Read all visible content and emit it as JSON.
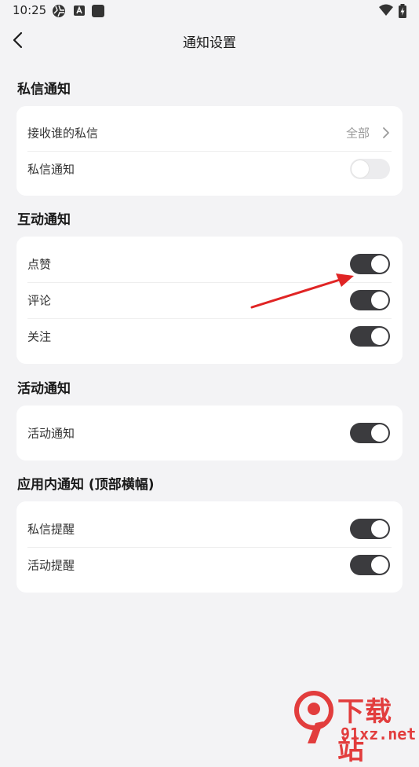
{
  "status_bar": {
    "time": "10:25",
    "icons": [
      "aperture-icon",
      "a-box-icon",
      "square-icon",
      "wifi-icon",
      "battery-charging-icon"
    ]
  },
  "header": {
    "title": "通知设置",
    "back_icon": "chevron-left-icon"
  },
  "sections": [
    {
      "title": "私信通知",
      "rows": [
        {
          "label": "接收谁的私信",
          "value": "全部",
          "type": "link"
        },
        {
          "label": "私信通知",
          "type": "toggle",
          "on": false
        }
      ]
    },
    {
      "title": "互动通知",
      "rows": [
        {
          "label": "点赞",
          "type": "toggle",
          "on": true
        },
        {
          "label": "评论",
          "type": "toggle",
          "on": true
        },
        {
          "label": "关注",
          "type": "toggle",
          "on": true
        }
      ]
    },
    {
      "title": "活动通知",
      "rows": [
        {
          "label": "活动通知",
          "type": "toggle",
          "on": true
        }
      ]
    },
    {
      "title": "应用内通知 (顶部横幅)",
      "rows": [
        {
          "label": "私信提醒",
          "type": "toggle",
          "on": true
        },
        {
          "label": "活动提醒",
          "type": "toggle",
          "on": true
        }
      ]
    }
  ],
  "annotation": {
    "arrow_color": "#e02424"
  },
  "watermark": {
    "line1": "下载站",
    "line2": "91xz.net",
    "color": "#e23d3d"
  },
  "colors": {
    "toggle_on": "#3b3b3e",
    "toggle_off": "#ececee",
    "background": "#f3f3f5",
    "card": "#ffffff"
  }
}
